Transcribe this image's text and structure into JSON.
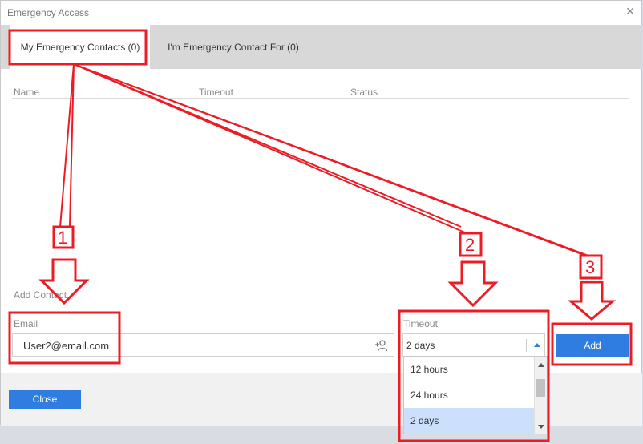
{
  "window": {
    "title": "Emergency Access",
    "close_glyph": "×"
  },
  "tabs": [
    {
      "label": "My Emergency Contacts (0)",
      "active": true
    },
    {
      "label": "I'm Emergency Contact For (0)",
      "active": false
    }
  ],
  "table": {
    "columns": [
      "Name",
      "Timeout",
      "Status"
    ]
  },
  "add_contact": {
    "section_label": "Add Contact",
    "email_label": "Email",
    "email_value": "User2@email.com",
    "email_icon": "add-person-icon",
    "timeout_label": "Timeout",
    "timeout_value": "2 days",
    "add_label": "Add"
  },
  "timeout_dropdown": {
    "options": [
      "12 hours",
      "24 hours",
      "2 days"
    ],
    "selected": "2 days"
  },
  "footer": {
    "close_label": "Close"
  },
  "annotations": {
    "labels": [
      "1",
      "2",
      "3"
    ],
    "color": "#ed1c24"
  },
  "colors": {
    "accent": "#2f7de1",
    "tab_bar": "#d8d8d8",
    "selected_option": "#cce0fb"
  }
}
